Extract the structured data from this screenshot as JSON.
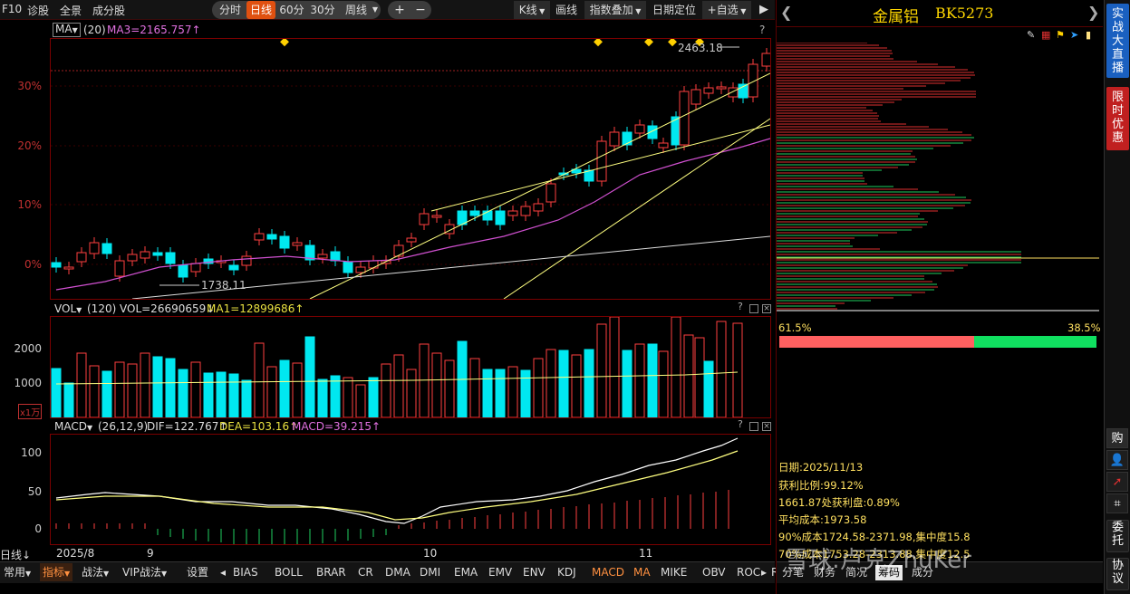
{
  "toolbar": {
    "left_items": [
      "F10",
      "诊股",
      "全景",
      "成分股"
    ],
    "periods": [
      "分时",
      "日线",
      "60分",
      "30分",
      "周线"
    ],
    "active_period": "日线",
    "nav_prev": "◂",
    "nav_next": "▸",
    "right_items": [
      "K线",
      "画线",
      "指数叠加",
      "日期定位",
      "+自选"
    ],
    "collapse": "▶"
  },
  "main_chart": {
    "indicator_label": "MA",
    "params": "(20)",
    "ma_readout": "MA3=2165.757↑",
    "y_ticks": [
      "30%",
      "20%",
      "10%",
      "0%"
    ],
    "high_label": "2463.18",
    "low_label": "1738.11",
    "help": "?"
  },
  "vol_chart": {
    "label": "VOL",
    "params": "(120)",
    "readout": "VOL=26690659↓",
    "ma_readout": "MA1=12899686↑",
    "y_ticks": [
      "2000",
      "1000"
    ],
    "unit": "x1万"
  },
  "macd_chart": {
    "label": "MACD",
    "params": "(26,12,9)",
    "dif": "DIF=122.767↑",
    "dea": "DEA=103.16↑",
    "macd": "MACD=39.215↑",
    "y_ticks": [
      "100",
      "50",
      "0"
    ]
  },
  "x_axis": {
    "period_label": "日线",
    "dates": [
      "2025/8",
      "9",
      "10",
      "11"
    ]
  },
  "bottom_tabs": {
    "menus": [
      "常用",
      "指标",
      "战法",
      "VIP战法",
      "设置"
    ],
    "indicators": [
      "BIAS",
      "BOLL",
      "BRAR",
      "CR",
      "DMA",
      "DMI",
      "EMA",
      "EMV",
      "ENV",
      "KDJ",
      "MACD",
      "MA",
      "MIKE",
      "OBV",
      "ROC",
      "RSI"
    ],
    "active_indicator": "MACD",
    "scroll_left": "◂",
    "scroll_right": "▸"
  },
  "right_panel": {
    "title": "金属铝",
    "code": "BK5273",
    "profit_pct": "61.5%",
    "loss_pct": "38.5%",
    "profit_ratio_value": 0.615,
    "info": [
      "日期:2025/11/13",
      "获利比例:99.12%",
      "1661.87处获利盘:0.89%",
      "平均成本:1973.58",
      "90%成本1724.58-2371.98,集中度15.8",
      "70%成本1753.28-2313.88,集中度12.5"
    ],
    "bottom_tabs": [
      "分笔",
      "财务",
      "简况",
      "筹码",
      "成分"
    ],
    "active_tab": "筹码"
  },
  "sidebar": {
    "live": "实战大直播",
    "promo": "限时优惠",
    "buy": "购",
    "sell_note": "委托",
    "protocol": "协议"
  },
  "watermark": "雪球:卢克ZhuKer",
  "colors": {
    "up": "#ff4040",
    "down": "#00e8f0",
    "accent": "#e05010",
    "ma": "#ffff80",
    "ma2": "#d050d0"
  },
  "chart_data": {
    "type": "candlestick",
    "dates_visible": [
      "2025/8",
      "9",
      "10",
      "11"
    ],
    "high": 2463.18,
    "low": 1738.11,
    "ma_value": 2165.757,
    "vol_ma": 12899686,
    "vol_last": 26690659,
    "macd": {
      "dif": 122.767,
      "dea": 103.16,
      "macd": 39.215
    },
    "chip": {
      "profit_ratio": 99.12,
      "avg_cost": 1973.58
    }
  }
}
